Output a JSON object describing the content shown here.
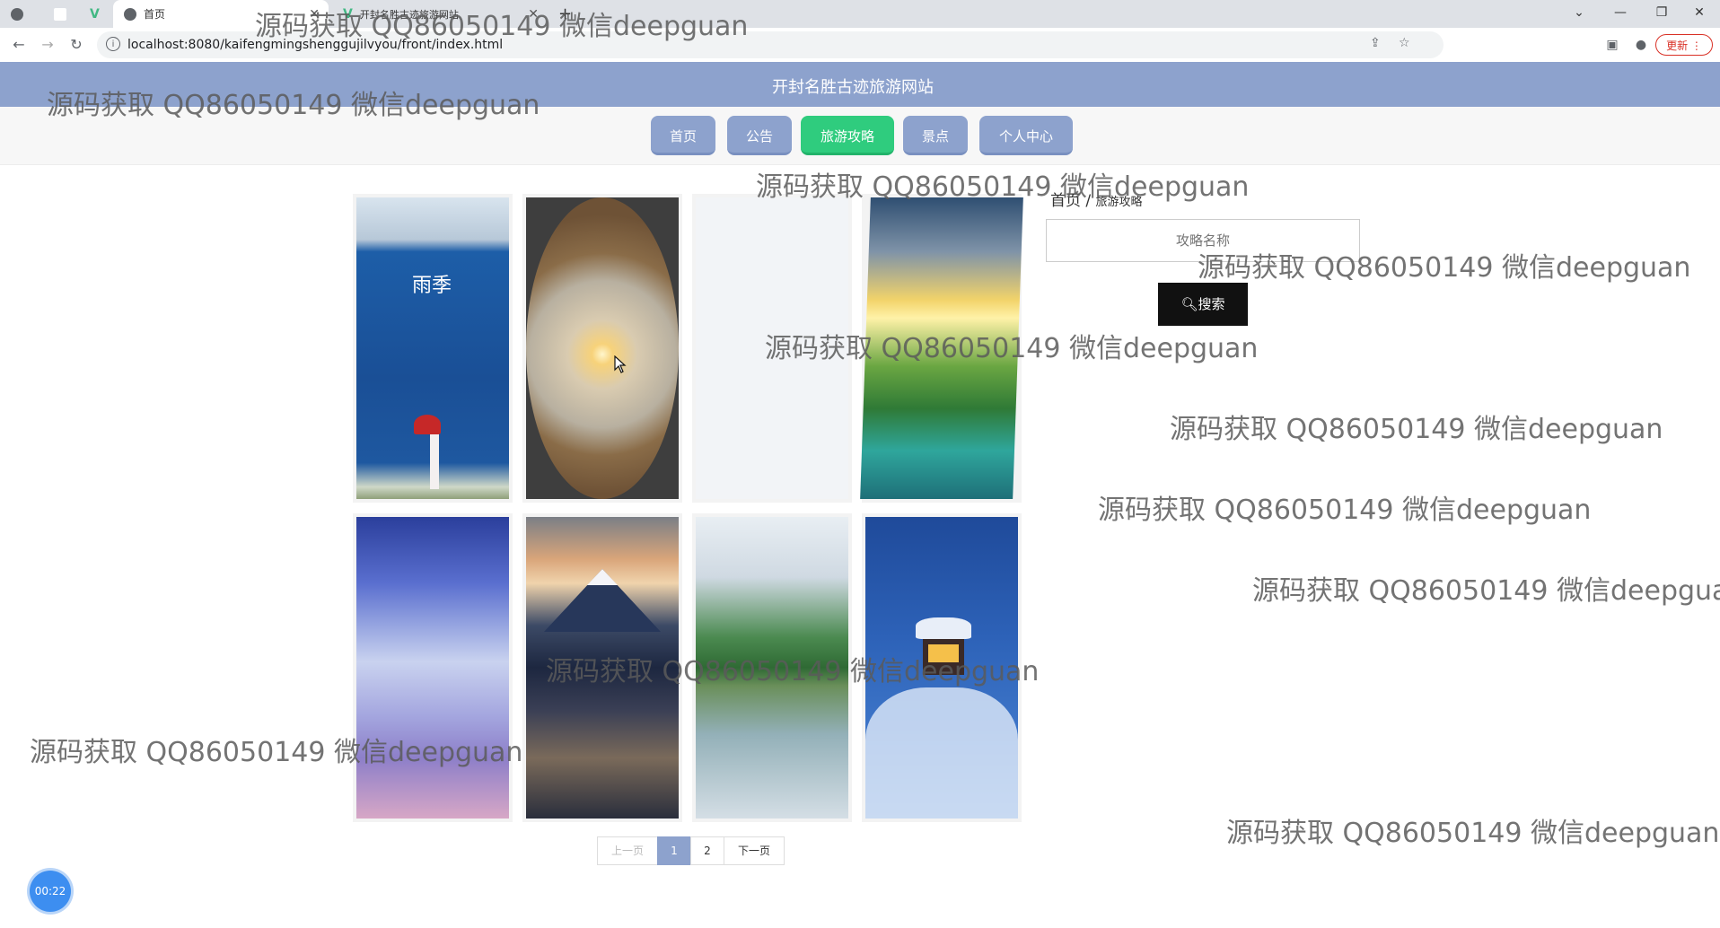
{
  "browser": {
    "tabs": [
      {
        "label": "首页"
      },
      {
        "label": "开封名胜古迹旅游网站"
      }
    ],
    "new_tab_symbol": "+",
    "url": "localhost:8080/kaifengmingshenggujilvyou/front/index.html",
    "update_label": "更新",
    "window_controls": {
      "collapse": "⌄",
      "minimize": "—",
      "restore": "❐",
      "close": "✕"
    }
  },
  "site": {
    "title": "开封名胜古迹旅游网站"
  },
  "nav": {
    "items": [
      {
        "label": "首页",
        "active": false
      },
      {
        "label": "公告",
        "active": false
      },
      {
        "label": "旅游攻略",
        "active": true
      },
      {
        "label": "景点",
        "active": false
      },
      {
        "label": "个人中心",
        "active": false
      }
    ]
  },
  "breadcrumb": {
    "home": "首页",
    "separator": "/",
    "current": "旅游攻略"
  },
  "search": {
    "placeholder": "攻略名称",
    "button_label": "搜索"
  },
  "gallery": {
    "items": [
      {
        "scene": "lake-with-red-umbrella-figure",
        "caption_text": "雨季"
      },
      {
        "scene": "desert-sunset-oval"
      },
      {
        "scene": "blank"
      },
      {
        "scene": "sunlight-green-valley-lake"
      },
      {
        "scene": "purple-sky-clouds"
      },
      {
        "scene": "mountain-over-city-night"
      },
      {
        "scene": "karst-hills-reflection"
      },
      {
        "scene": "snow-cabin-night"
      }
    ]
  },
  "pagination": {
    "prev": "上一页",
    "pages": [
      "1",
      "2"
    ],
    "current": "1",
    "next": "下一页"
  },
  "timer": "00:22",
  "watermark": "源码获取 QQ86050149 微信deepguan",
  "colors": {
    "header": "#8da2cd",
    "active_nav": "#2fcc7e",
    "search_button": "#111111"
  }
}
